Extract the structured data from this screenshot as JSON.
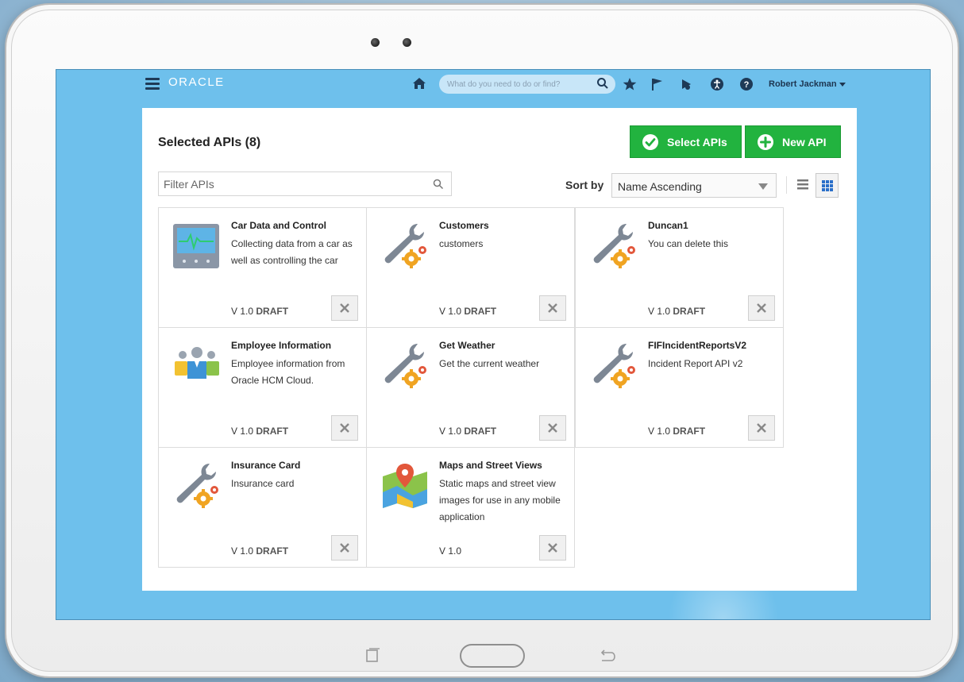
{
  "header": {
    "logo": "ORACLE",
    "search_placeholder": "What do you need to do or find?",
    "user_name": "Robert Jackman"
  },
  "page": {
    "title": "Selected APIs (8)",
    "select_button": "Select APIs",
    "new_button": "New API",
    "filter_placeholder": "Filter APIs",
    "sort_label": "Sort by",
    "sort_value": "Name Ascending"
  },
  "apis": [
    {
      "title": "Car Data and Control",
      "desc": "Collecting data from a car as well as controlling the car",
      "version": "V 1.0",
      "status": "DRAFT",
      "icon": "car-monitor-icon"
    },
    {
      "title": "Customers",
      "desc": "customers",
      "version": "V 1.0",
      "status": "DRAFT",
      "icon": "wrench-gear-icon"
    },
    {
      "title": "Duncan1",
      "desc": "You can delete this",
      "version": "V 1.0",
      "status": "DRAFT",
      "icon": "wrench-gear-icon"
    },
    {
      "title": "Employee Information",
      "desc": "Employee information from Oracle HCM Cloud.",
      "version": "V 1.0",
      "status": "DRAFT",
      "icon": "people-icon"
    },
    {
      "title": "Get Weather",
      "desc": "Get the current weather",
      "version": "V 1.0",
      "status": "DRAFT",
      "icon": "wrench-gear-icon"
    },
    {
      "title": "FIFIncidentReportsV2",
      "desc": "Incident Report API v2",
      "version": "V 1.0",
      "status": "DRAFT",
      "icon": "wrench-gear-icon"
    },
    {
      "title": "Insurance Card",
      "desc": "Insurance card",
      "version": "V 1.0",
      "status": "DRAFT",
      "icon": "wrench-gear-icon"
    },
    {
      "title": "Maps and Street Views",
      "desc": "Static maps and street view images for use in any mobile application",
      "version": "V 1.0",
      "status": "",
      "icon": "map-pin-icon"
    }
  ],
  "colors": {
    "screen_bg": "#6ec0ec",
    "primary_button": "#22b33f",
    "text_dark": "#222222"
  }
}
